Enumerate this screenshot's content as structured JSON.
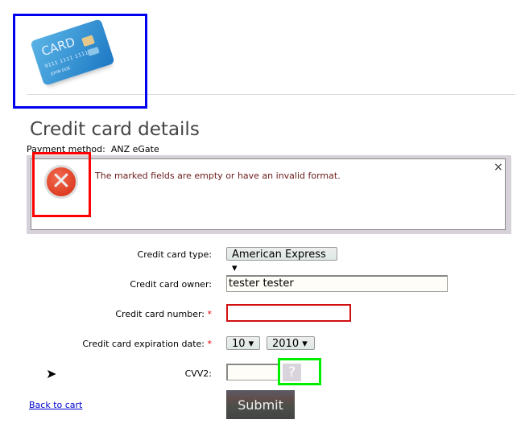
{
  "header": {
    "logo": {
      "card_text": "CARD",
      "number": "9111 1111 1111",
      "owner": "JOHN DOE"
    }
  },
  "page_title": "Credit card details",
  "payment_method": "Payment method:  ANZ eGate",
  "error": {
    "message": "The marked fields are empty or have an invalid format.",
    "icon": "error-x-icon",
    "close": "×"
  },
  "form": {
    "card_type": {
      "label": "Credit card type:",
      "value": "American Express ▾"
    },
    "owner": {
      "label": "Credit card owner:",
      "value": "tester tester"
    },
    "number": {
      "label": "Credit card number:",
      "required": "*",
      "value": ""
    },
    "expiry": {
      "label": "Credit card expiration date:",
      "required": "*",
      "month": "10 ▾",
      "year": "2010 ▾"
    },
    "cvv": {
      "label": "CVV2:",
      "value": "",
      "help": "?"
    },
    "submit": "Submit"
  },
  "back_link": "Back to cart",
  "colors": {
    "error_border": "#d01010",
    "annotation_blue": "#0000ee",
    "annotation_red": "#ff0000",
    "annotation_green": "#00ee00"
  }
}
